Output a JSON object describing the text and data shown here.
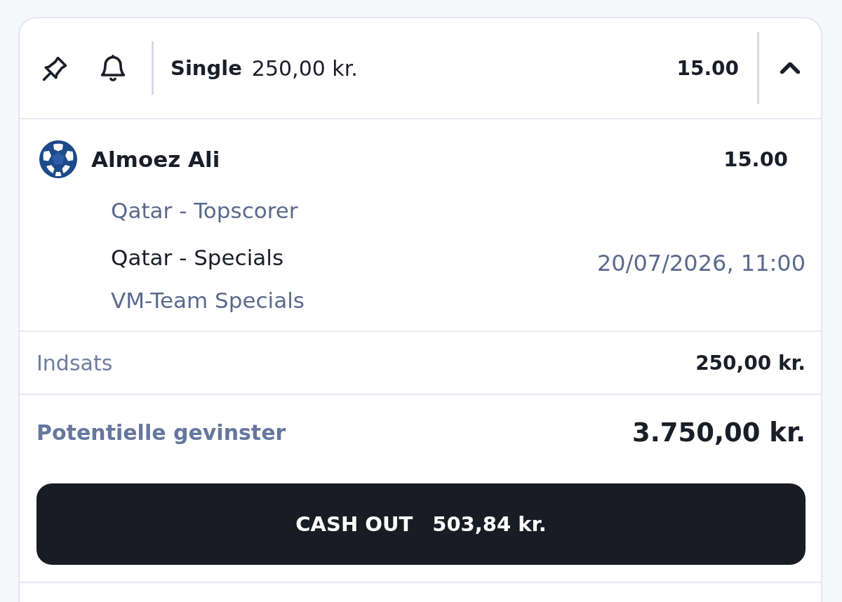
{
  "header": {
    "bet_type": "Single",
    "stake": "250,00 kr.",
    "odds": "15.00",
    "expanded": true
  },
  "selection": {
    "name": "Almoez Ali",
    "odds": "15.00",
    "market": "Qatar - Topscorer",
    "event": "Qatar - Specials",
    "date": "20/07/2026, 11:00",
    "competition": "VM-Team Specials"
  },
  "stake_row": {
    "label": "Indsats",
    "value": "250,00 kr."
  },
  "potential_winnings": {
    "label": "Potentielle gevinster",
    "value": "3.750,00 kr."
  },
  "cash_out_button": {
    "label": "CASH OUT",
    "amount": "503,84 kr."
  }
}
